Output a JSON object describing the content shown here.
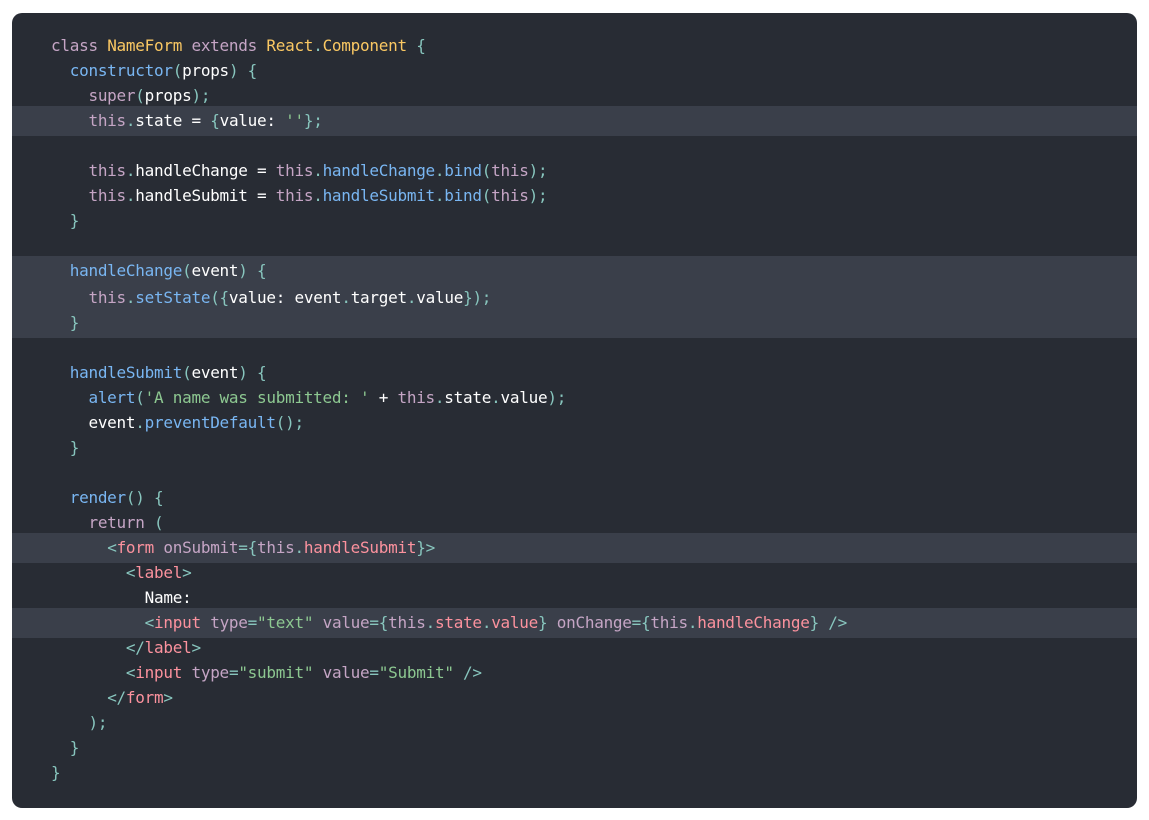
{
  "colors": {
    "background": "#282c34",
    "highlight": "#3a3f4a",
    "keyword": "#c5a5c5",
    "class_name": "#fac863",
    "function": "#79b6f2",
    "punctuation": "#88c6be",
    "string": "#8dc891",
    "tag": "#fc929e",
    "attr": "#c5a5c5",
    "plain": "#ffffff"
  },
  "code": {
    "lines": [
      {
        "highlighted": false,
        "tokens": [
          {
            "text": "class ",
            "type": "keyword"
          },
          {
            "text": "NameForm",
            "type": "class_name"
          },
          {
            "text": " extends ",
            "type": "keyword"
          },
          {
            "text": "React",
            "type": "class_name"
          },
          {
            "text": ".",
            "type": "punctuation"
          },
          {
            "text": "Component",
            "type": "class_name"
          },
          {
            "text": " {",
            "type": "punctuation"
          }
        ]
      },
      {
        "highlighted": false,
        "tokens": [
          {
            "text": "  ",
            "type": "plain"
          },
          {
            "text": "constructor",
            "type": "function"
          },
          {
            "text": "(",
            "type": "punctuation"
          },
          {
            "text": "props",
            "type": "plain"
          },
          {
            "text": ") {",
            "type": "punctuation"
          }
        ]
      },
      {
        "highlighted": false,
        "tokens": [
          {
            "text": "    ",
            "type": "plain"
          },
          {
            "text": "super",
            "type": "keyword"
          },
          {
            "text": "(",
            "type": "punctuation"
          },
          {
            "text": "props",
            "type": "plain"
          },
          {
            "text": ");",
            "type": "punctuation"
          }
        ]
      },
      {
        "highlighted": true,
        "tokens": [
          {
            "text": "    ",
            "type": "plain"
          },
          {
            "text": "this",
            "type": "keyword"
          },
          {
            "text": ".",
            "type": "punctuation"
          },
          {
            "text": "state",
            "type": "plain"
          },
          {
            "text": " = ",
            "type": "plain"
          },
          {
            "text": "{",
            "type": "punctuation"
          },
          {
            "text": "value",
            "type": "plain"
          },
          {
            "text": ": ",
            "type": "plain"
          },
          {
            "text": "''",
            "type": "string"
          },
          {
            "text": "};",
            "type": "punctuation"
          }
        ]
      },
      {
        "highlighted": false,
        "tokens": []
      },
      {
        "highlighted": false,
        "tokens": [
          {
            "text": "    ",
            "type": "plain"
          },
          {
            "text": "this",
            "type": "keyword"
          },
          {
            "text": ".",
            "type": "punctuation"
          },
          {
            "text": "handleChange",
            "type": "plain"
          },
          {
            "text": " = ",
            "type": "plain"
          },
          {
            "text": "this",
            "type": "keyword"
          },
          {
            "text": ".",
            "type": "punctuation"
          },
          {
            "text": "handleChange",
            "type": "function"
          },
          {
            "text": ".",
            "type": "punctuation"
          },
          {
            "text": "bind",
            "type": "function"
          },
          {
            "text": "(",
            "type": "punctuation"
          },
          {
            "text": "this",
            "type": "keyword"
          },
          {
            "text": ");",
            "type": "punctuation"
          }
        ]
      },
      {
        "highlighted": false,
        "tokens": [
          {
            "text": "    ",
            "type": "plain"
          },
          {
            "text": "this",
            "type": "keyword"
          },
          {
            "text": ".",
            "type": "punctuation"
          },
          {
            "text": "handleSubmit",
            "type": "plain"
          },
          {
            "text": " = ",
            "type": "plain"
          },
          {
            "text": "this",
            "type": "keyword"
          },
          {
            "text": ".",
            "type": "punctuation"
          },
          {
            "text": "handleSubmit",
            "type": "function"
          },
          {
            "text": ".",
            "type": "punctuation"
          },
          {
            "text": "bind",
            "type": "function"
          },
          {
            "text": "(",
            "type": "punctuation"
          },
          {
            "text": "this",
            "type": "keyword"
          },
          {
            "text": ");",
            "type": "punctuation"
          }
        ]
      },
      {
        "highlighted": false,
        "tokens": [
          {
            "text": "  ",
            "type": "plain"
          },
          {
            "text": "}",
            "type": "punctuation"
          }
        ]
      },
      {
        "highlighted": false,
        "tokens": []
      },
      {
        "highlighted": true,
        "tokens": [
          {
            "text": "  ",
            "type": "plain"
          },
          {
            "text": "handleChange",
            "type": "function"
          },
          {
            "text": "(",
            "type": "punctuation"
          },
          {
            "text": "event",
            "type": "plain"
          },
          {
            "text": ") {",
            "type": "punctuation"
          }
        ]
      },
      {
        "highlighted": true,
        "tokens": [
          {
            "text": "    ",
            "type": "plain"
          },
          {
            "text": "this",
            "type": "keyword"
          },
          {
            "text": ".",
            "type": "punctuation"
          },
          {
            "text": "setState",
            "type": "function"
          },
          {
            "text": "({",
            "type": "punctuation"
          },
          {
            "text": "value",
            "type": "plain"
          },
          {
            "text": ": ",
            "type": "plain"
          },
          {
            "text": "event",
            "type": "plain"
          },
          {
            "text": ".",
            "type": "punctuation"
          },
          {
            "text": "target",
            "type": "plain"
          },
          {
            "text": ".",
            "type": "punctuation"
          },
          {
            "text": "value",
            "type": "plain"
          },
          {
            "text": "});",
            "type": "punctuation"
          }
        ]
      },
      {
        "highlighted": true,
        "tokens": [
          {
            "text": "  ",
            "type": "plain"
          },
          {
            "text": "}",
            "type": "punctuation"
          }
        ]
      },
      {
        "highlighted": false,
        "tokens": []
      },
      {
        "highlighted": false,
        "tokens": [
          {
            "text": "  ",
            "type": "plain"
          },
          {
            "text": "handleSubmit",
            "type": "function"
          },
          {
            "text": "(",
            "type": "punctuation"
          },
          {
            "text": "event",
            "type": "plain"
          },
          {
            "text": ") {",
            "type": "punctuation"
          }
        ]
      },
      {
        "highlighted": false,
        "tokens": [
          {
            "text": "    ",
            "type": "plain"
          },
          {
            "text": "alert",
            "type": "function"
          },
          {
            "text": "(",
            "type": "punctuation"
          },
          {
            "text": "'A name was submitted: '",
            "type": "string"
          },
          {
            "text": " + ",
            "type": "plain"
          },
          {
            "text": "this",
            "type": "keyword"
          },
          {
            "text": ".",
            "type": "punctuation"
          },
          {
            "text": "state",
            "type": "plain"
          },
          {
            "text": ".",
            "type": "punctuation"
          },
          {
            "text": "value",
            "type": "plain"
          },
          {
            "text": ");",
            "type": "punctuation"
          }
        ]
      },
      {
        "highlighted": false,
        "tokens": [
          {
            "text": "    ",
            "type": "plain"
          },
          {
            "text": "event",
            "type": "plain"
          },
          {
            "text": ".",
            "type": "punctuation"
          },
          {
            "text": "preventDefault",
            "type": "function"
          },
          {
            "text": "();",
            "type": "punctuation"
          }
        ]
      },
      {
        "highlighted": false,
        "tokens": [
          {
            "text": "  ",
            "type": "plain"
          },
          {
            "text": "}",
            "type": "punctuation"
          }
        ]
      },
      {
        "highlighted": false,
        "tokens": []
      },
      {
        "highlighted": false,
        "tokens": [
          {
            "text": "  ",
            "type": "plain"
          },
          {
            "text": "render",
            "type": "function"
          },
          {
            "text": "() {",
            "type": "punctuation"
          }
        ]
      },
      {
        "highlighted": false,
        "tokens": [
          {
            "text": "    ",
            "type": "plain"
          },
          {
            "text": "return",
            "type": "keyword"
          },
          {
            "text": " (",
            "type": "punctuation"
          }
        ]
      },
      {
        "highlighted": true,
        "tokens": [
          {
            "text": "      ",
            "type": "plain"
          },
          {
            "text": "<",
            "type": "punctuation"
          },
          {
            "text": "form",
            "type": "tag"
          },
          {
            "text": " onSubmit",
            "type": "attr"
          },
          {
            "text": "={",
            "type": "punctuation"
          },
          {
            "text": "this",
            "type": "keyword"
          },
          {
            "text": ".",
            "type": "punctuation"
          },
          {
            "text": "handleSubmit",
            "type": "tag"
          },
          {
            "text": "}>",
            "type": "punctuation"
          }
        ]
      },
      {
        "highlighted": false,
        "tokens": [
          {
            "text": "        ",
            "type": "plain"
          },
          {
            "text": "<",
            "type": "punctuation"
          },
          {
            "text": "label",
            "type": "tag"
          },
          {
            "text": ">",
            "type": "punctuation"
          }
        ]
      },
      {
        "highlighted": false,
        "tokens": [
          {
            "text": "          ",
            "type": "plain"
          },
          {
            "text": "Name:",
            "type": "plain"
          }
        ]
      },
      {
        "highlighted": true,
        "tokens": [
          {
            "text": "          ",
            "type": "plain"
          },
          {
            "text": "<",
            "type": "punctuation"
          },
          {
            "text": "input",
            "type": "tag"
          },
          {
            "text": " type",
            "type": "attr"
          },
          {
            "text": "=",
            "type": "punctuation"
          },
          {
            "text": "\"text\"",
            "type": "string"
          },
          {
            "text": " value",
            "type": "attr"
          },
          {
            "text": "={",
            "type": "punctuation"
          },
          {
            "text": "this",
            "type": "keyword"
          },
          {
            "text": ".",
            "type": "punctuation"
          },
          {
            "text": "state",
            "type": "tag"
          },
          {
            "text": ".",
            "type": "punctuation"
          },
          {
            "text": "value",
            "type": "tag"
          },
          {
            "text": "}",
            "type": "punctuation"
          },
          {
            "text": " onChange",
            "type": "attr"
          },
          {
            "text": "={",
            "type": "punctuation"
          },
          {
            "text": "this",
            "type": "keyword"
          },
          {
            "text": ".",
            "type": "punctuation"
          },
          {
            "text": "handleChange",
            "type": "tag"
          },
          {
            "text": "} />",
            "type": "punctuation"
          }
        ]
      },
      {
        "highlighted": false,
        "tokens": [
          {
            "text": "        ",
            "type": "plain"
          },
          {
            "text": "</",
            "type": "punctuation"
          },
          {
            "text": "label",
            "type": "tag"
          },
          {
            "text": ">",
            "type": "punctuation"
          }
        ]
      },
      {
        "highlighted": false,
        "tokens": [
          {
            "text": "        ",
            "type": "plain"
          },
          {
            "text": "<",
            "type": "punctuation"
          },
          {
            "text": "input",
            "type": "tag"
          },
          {
            "text": " type",
            "type": "attr"
          },
          {
            "text": "=",
            "type": "punctuation"
          },
          {
            "text": "\"submit\"",
            "type": "string"
          },
          {
            "text": " value",
            "type": "attr"
          },
          {
            "text": "=",
            "type": "punctuation"
          },
          {
            "text": "\"Submit\"",
            "type": "string"
          },
          {
            "text": " />",
            "type": "punctuation"
          }
        ]
      },
      {
        "highlighted": false,
        "tokens": [
          {
            "text": "      ",
            "type": "plain"
          },
          {
            "text": "</",
            "type": "punctuation"
          },
          {
            "text": "form",
            "type": "tag"
          },
          {
            "text": ">",
            "type": "punctuation"
          }
        ]
      },
      {
        "highlighted": false,
        "tokens": [
          {
            "text": "    ",
            "type": "plain"
          },
          {
            "text": ");",
            "type": "punctuation"
          }
        ]
      },
      {
        "highlighted": false,
        "tokens": [
          {
            "text": "  ",
            "type": "plain"
          },
          {
            "text": "}",
            "type": "punctuation"
          }
        ]
      },
      {
        "highlighted": false,
        "tokens": [
          {
            "text": "}",
            "type": "punctuation"
          }
        ]
      }
    ]
  }
}
